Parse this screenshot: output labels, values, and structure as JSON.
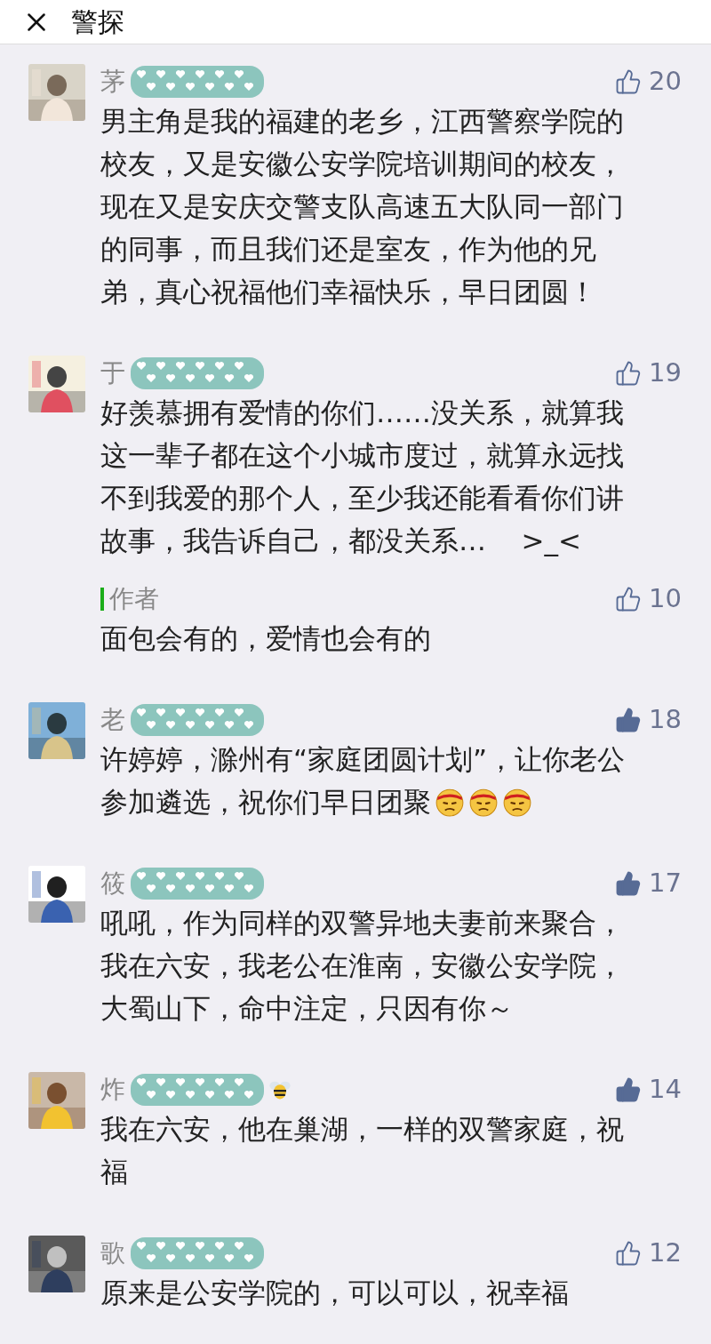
{
  "header": {
    "title": "警探"
  },
  "comments": [
    {
      "name": "茅",
      "likes": "20",
      "liked": false,
      "text": "男主角是我的福建的老乡，江西警察学院的校友，又是安徽公安学院培训期间的校友，现在又是安庆交警支队高速五大队同一部门的同事，而且我们还是室友，作为他的兄弟，真心祝福他们幸福快乐，早日团圆！"
    },
    {
      "name": "于",
      "likes": "19",
      "liked": false,
      "text": "好羡慕拥有爱情的你们……没关系，就算我这一辈子都在这个小城市度过，就算永远找不到我爱的那个人，至少我还能看看你们讲故事，我告诉自己，都没关系…    >_<",
      "reply": {
        "label": "作者",
        "likes": "10",
        "liked": false,
        "text": "面包会有的，爱情也会有的"
      }
    },
    {
      "name": "老",
      "likes": "18",
      "liked": true,
      "text": "许婷婷，滁州有“家庭团圆计划”，让你老公参加遴选，祝你们早日团聚",
      "emojis": [
        {
          "kind": "headband"
        },
        {
          "kind": "headband"
        },
        {
          "kind": "headband"
        }
      ]
    },
    {
      "name": "筱",
      "likes": "17",
      "liked": true,
      "text": "吼吼，作为同样的双警异地夫妻前来聚合，我在六安，我老公在淮南，安徽公安学院，大蜀山下，命中注定，只因有你～"
    },
    {
      "name": "炸",
      "likes": "14",
      "liked": true,
      "text": "我在六安，他在巢湖，一样的双警家庭，祝福",
      "name_icon": {
        "kind": "bee"
      }
    },
    {
      "name": "歌",
      "likes": "12",
      "liked": false,
      "text": "原来是公安学院的，可以可以，祝幸福"
    }
  ]
}
